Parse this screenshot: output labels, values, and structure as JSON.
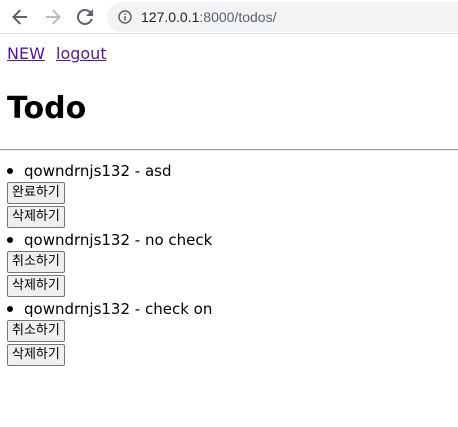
{
  "browser": {
    "url_host": "127.0.0.1",
    "url_path": ":8000/todos/",
    "back_icon": "arrow-left-icon",
    "forward_icon": "arrow-right-icon",
    "reload_icon": "reload-icon",
    "info_icon": "info-icon"
  },
  "nav": {
    "new_label": "NEW",
    "logout_label": "logout"
  },
  "heading": "Todo",
  "todos": [
    {
      "text": "qowndrnjs132 - asd",
      "action_label": "완료하기",
      "delete_label": "삭제하기"
    },
    {
      "text": "qowndrnjs132 - no check",
      "action_label": "취소하기",
      "delete_label": "삭제하기"
    },
    {
      "text": "qowndrnjs132 - check on",
      "action_label": "취소하기",
      "delete_label": "삭제하기"
    }
  ],
  "colors": {
    "link_visited": "#551a8b",
    "omnibox_bg": "#f1f3f4",
    "icon_gray": "#5f6368"
  }
}
